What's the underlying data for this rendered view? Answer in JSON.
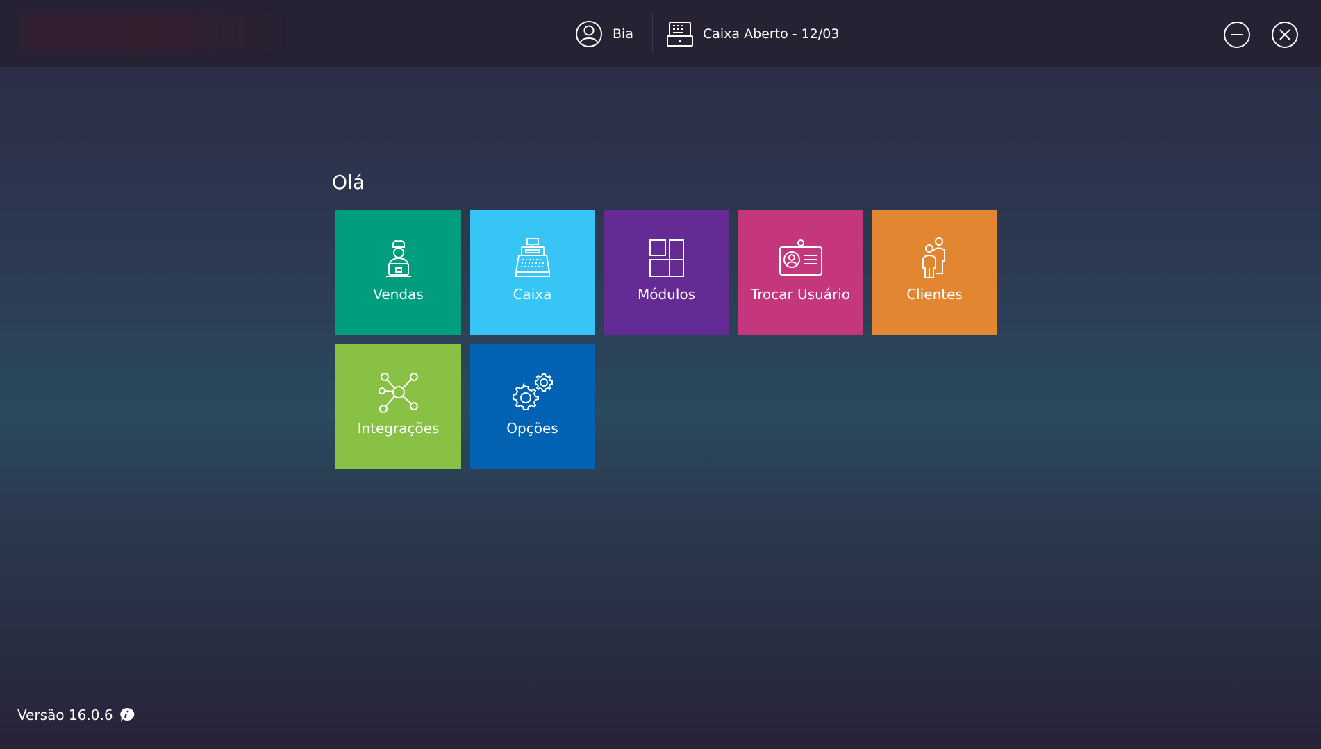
{
  "header": {
    "user_name": "Bia",
    "caixa_status": "Caixa Aberto - 12/03",
    "icons": {
      "user": "user-circle-icon",
      "register": "cash-register-icon",
      "minimize": "minimize-icon",
      "close": "close-icon"
    }
  },
  "main": {
    "greeting": "Olá",
    "tiles": [
      {
        "label": "Vendas",
        "icon": "seller-laptop-icon",
        "color": "#009d7e"
      },
      {
        "label": "Caixa",
        "icon": "cash-register-icon",
        "color": "#37c5f5"
      },
      {
        "label": "Módulos",
        "icon": "modules-icon",
        "color": "#632b93"
      },
      {
        "label": "Trocar Usuário",
        "icon": "id-card-icon",
        "color": "#c5377c"
      },
      {
        "label": "Clientes",
        "icon": "people-icon",
        "color": "#e28632"
      },
      {
        "label": "Integrações",
        "icon": "network-icon",
        "color": "#89c145"
      },
      {
        "label": "Opções",
        "icon": "gears-icon",
        "color": "#0161b3"
      }
    ]
  },
  "footer": {
    "version": "Versão 16.0.6",
    "icon": "info-icon"
  }
}
